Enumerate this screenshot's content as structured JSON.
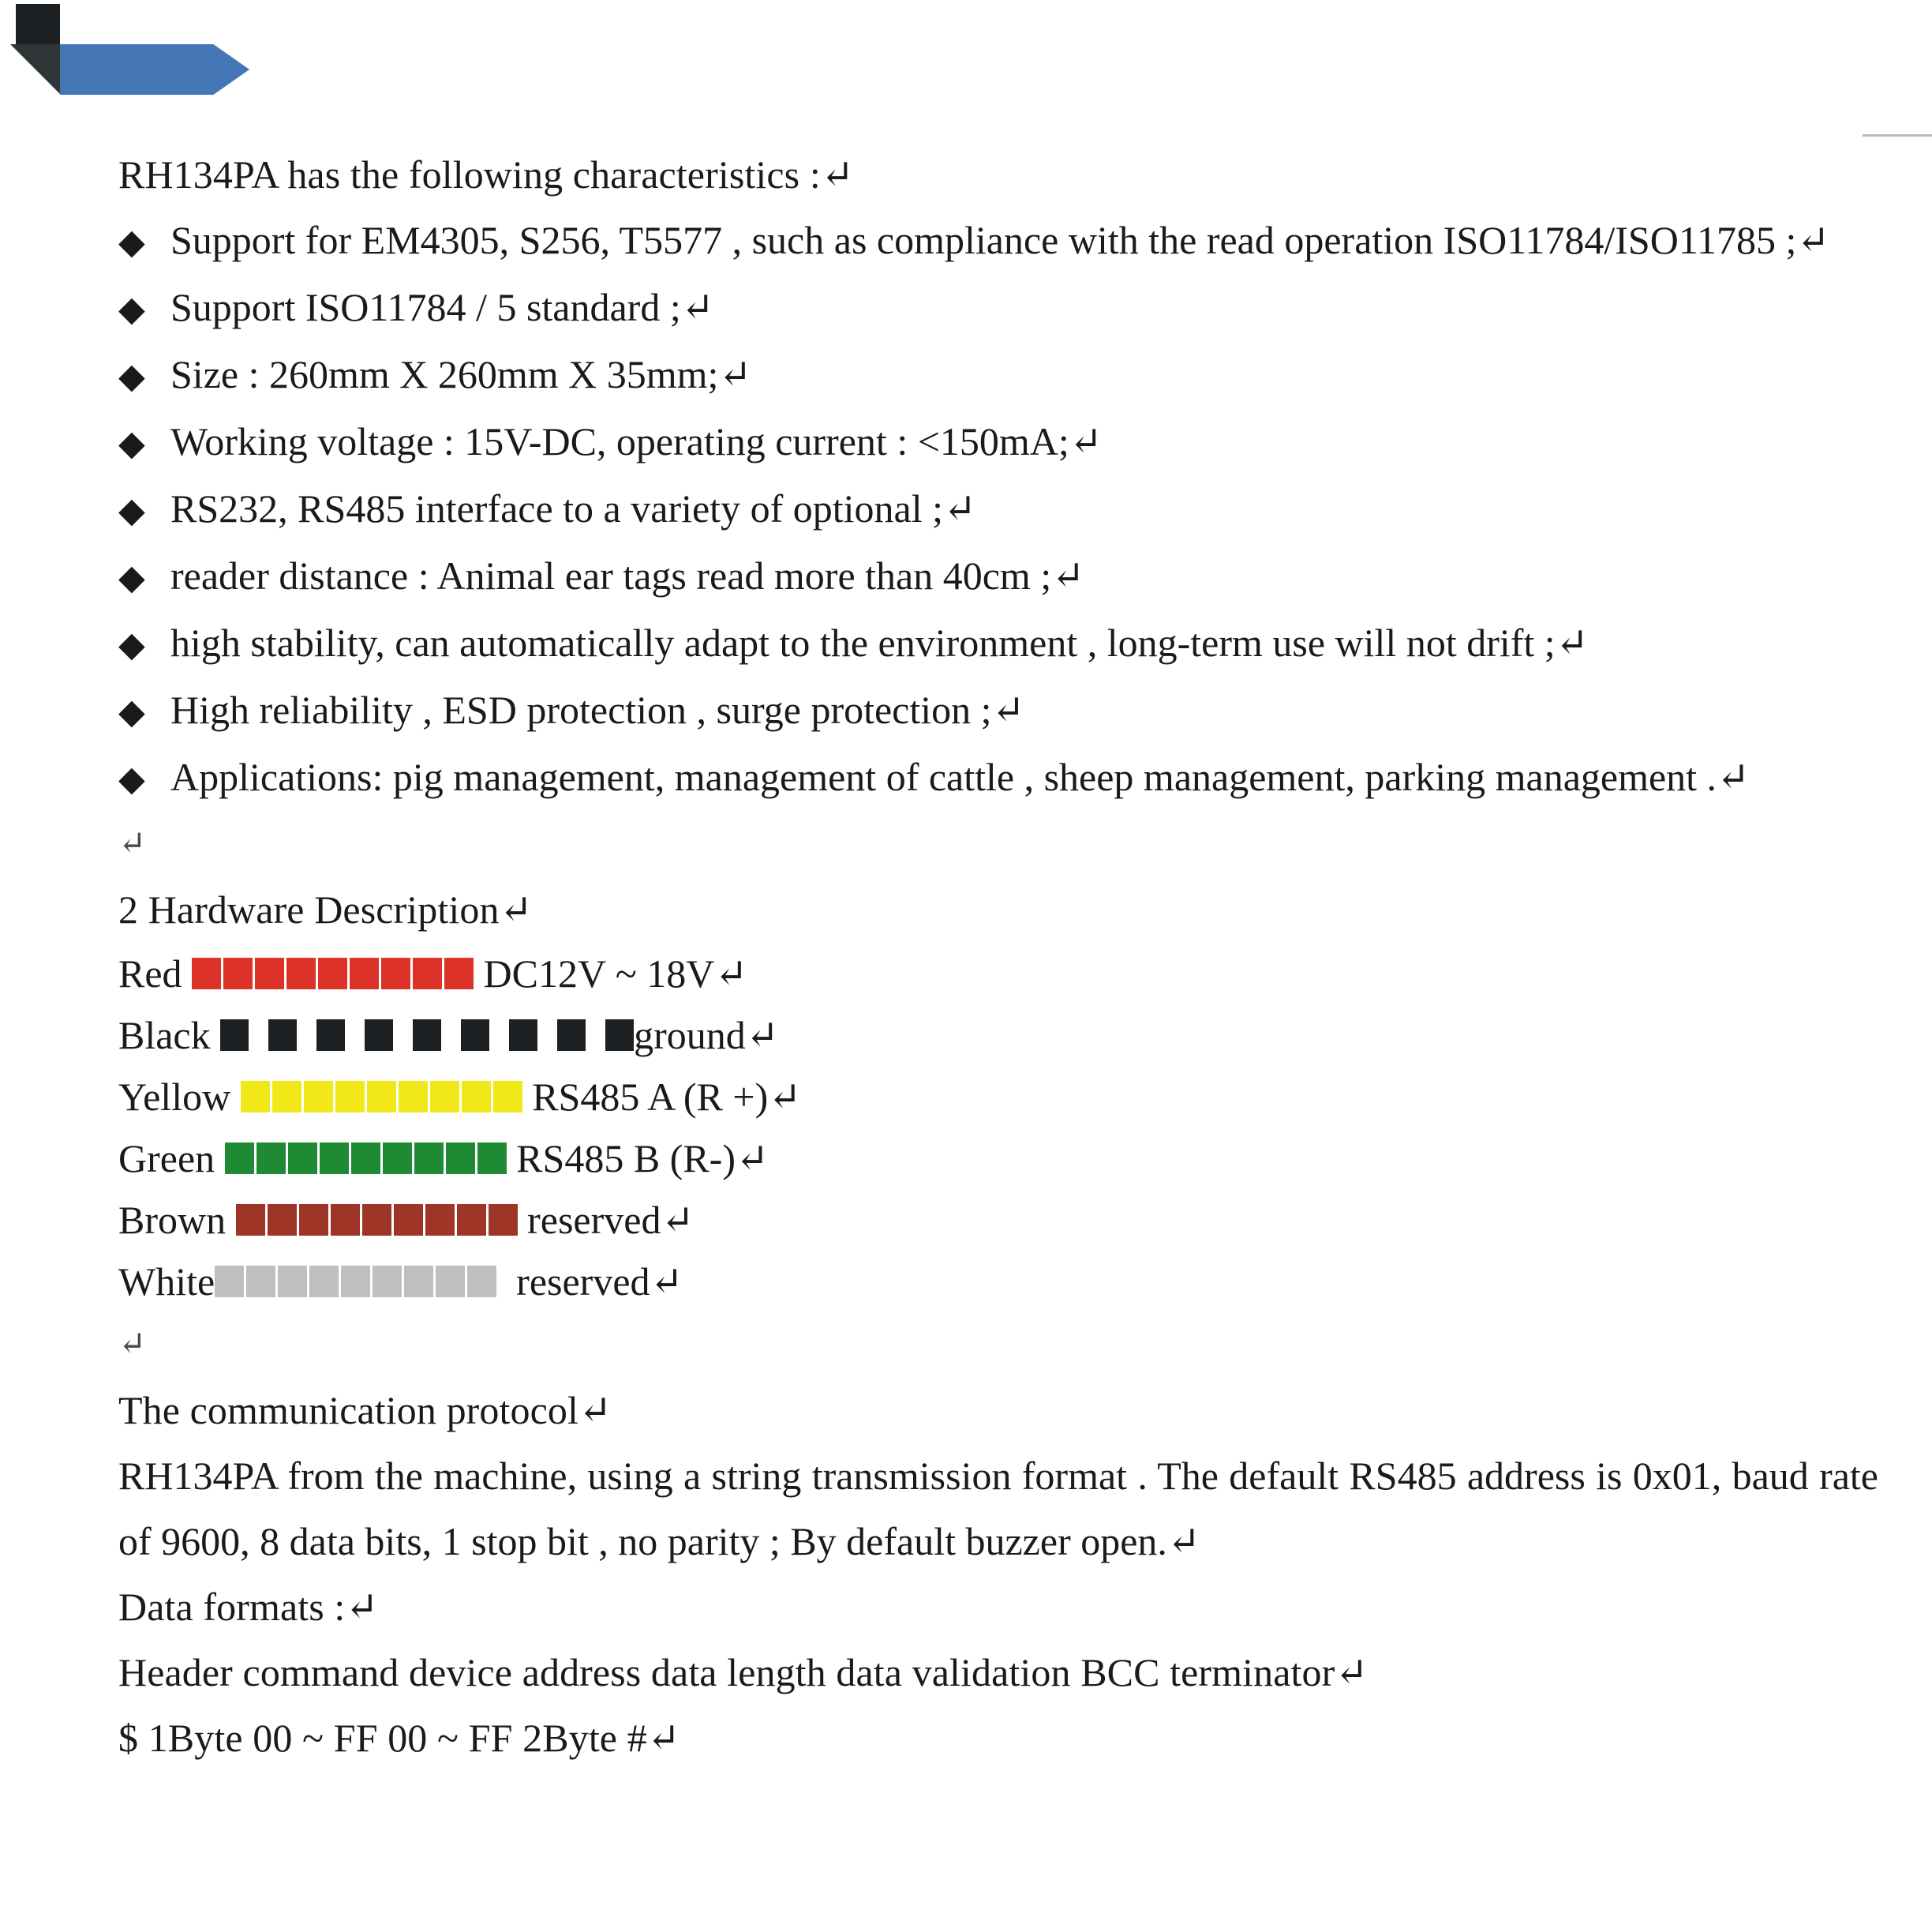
{
  "banner": {
    "accent_blue": "#4576b6",
    "accent_dark": "#1d2023",
    "shadow_dark": "#303538"
  },
  "document": {
    "intro_line": "RH134PA has the following characteristics :↵",
    "bullet_glyph": "◆",
    "bullets": [
      "Support  for  EM4305,  S256,  T5577 ,  such  as  compliance  with  the  read  operation ISO11784/ISO11785 ;↵",
      "Support ISO11784 / 5 standard ;↵",
      "Size : 260mm X 260mm X 35mm;↵",
      "Working voltage : 15V-DC, operating current : <150mA;↵",
      "RS232, RS485 interface to a variety of optional ;↵",
      "reader distance : Animal ear tags read more than 40cm ;↵",
      "high stability, can automatically adapt to the environment , long-term use will not drift ;↵",
      "High reliability , ESD protection , surge protection ;↵",
      "Applications:  pig  management,  management  of  cattle ,  sheep  management,  parking management .↵"
    ],
    "blank_mark": "↵",
    "hardware_heading": "2 Hardware Description↵",
    "wires": [
      {
        "name": "Red ",
        "color": "#dc3228",
        "segments": 9,
        "gapped": false,
        "description": " DC12V ~ 18V↵"
      },
      {
        "name": "Black ",
        "color": "#1d2023",
        "segments": 9,
        "gapped": true,
        "description": "ground↵"
      },
      {
        "name": "Yellow ",
        "color": "#f2e817",
        "segments": 9,
        "gapped": false,
        "description": " RS485 A (R +)↵"
      },
      {
        "name": "Green ",
        "color": "#1f8a34",
        "segments": 9,
        "gapped": false,
        "description": " RS485 B (R-)↵"
      },
      {
        "name": "Brown ",
        "color": "#9e3526",
        "segments": 9,
        "gapped": false,
        "description": " reserved↵"
      },
      {
        "name": "White",
        "color": "#bfbfbf",
        "segments": 9,
        "gapped": false,
        "description": "  reserved↵"
      }
    ],
    "protocol_heading": "The communication protocol↵",
    "protocol_paragraph": "RH134PA  from  the  machine,  using  a  string  transmission  format .  The  default  RS485  address  is 0x01, baud rate of 9600, 8 data bits, 1 stop bit , no parity ; By default buzzer open.↵",
    "data_formats_label": "Data formats :↵",
    "data_format_fields": "Header command device address data length data validation BCC terminator↵",
    "data_format_values": "$ 1Byte 00 ~ FF 00 ~ FF 2Byte #↵"
  }
}
